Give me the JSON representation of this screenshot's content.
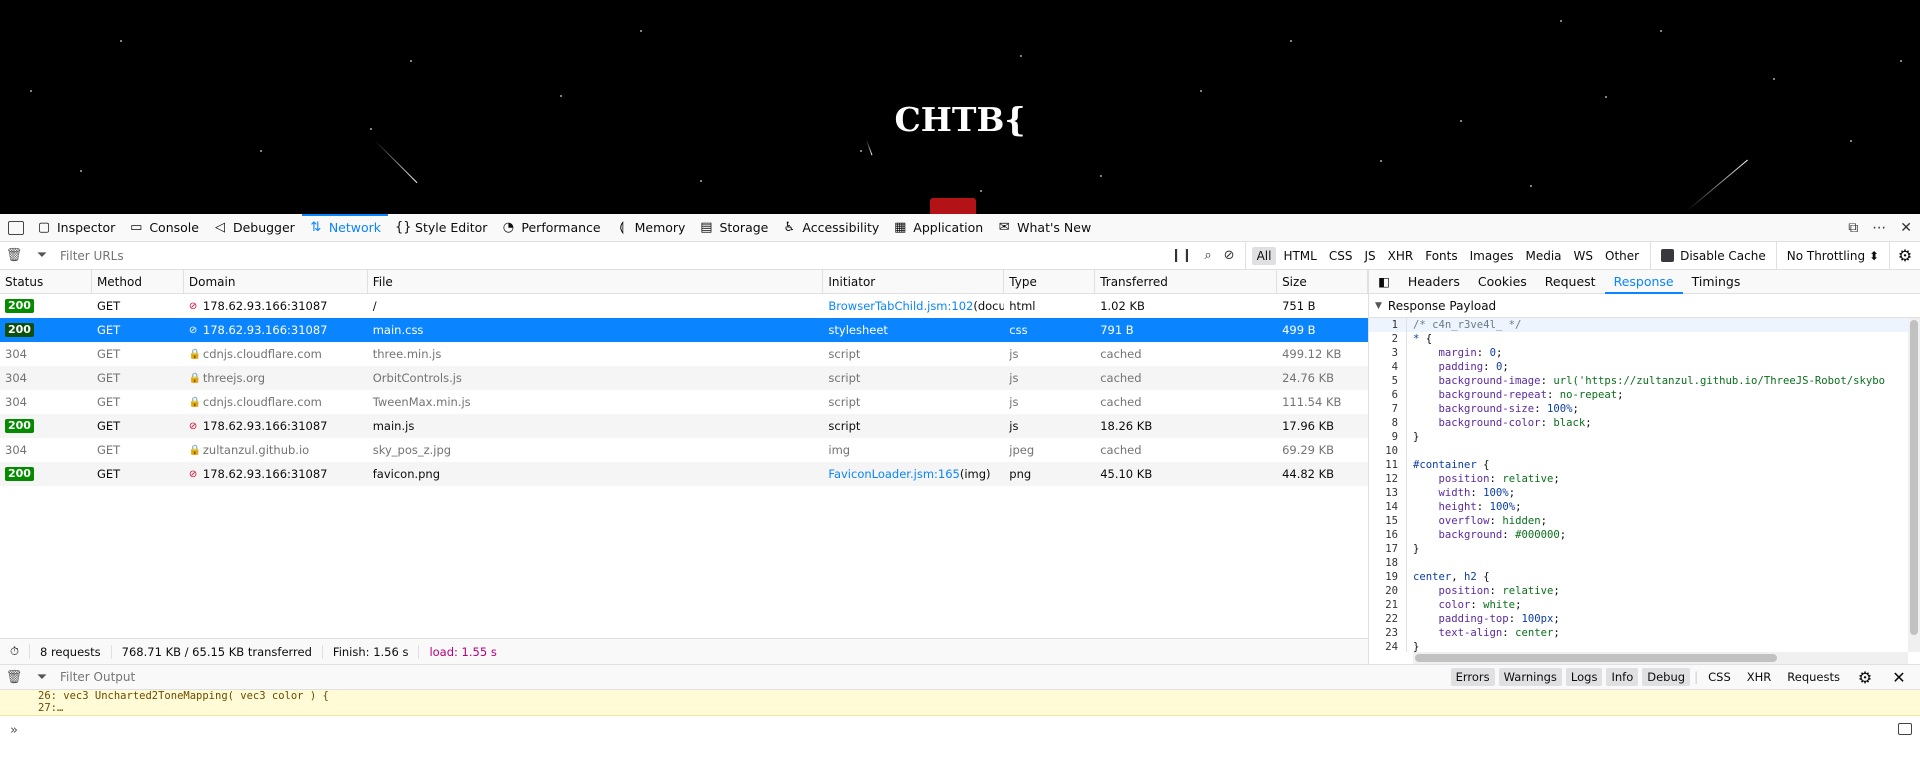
{
  "page": {
    "heading": "CHTB{"
  },
  "toolbar": {
    "tabs": [
      {
        "label": "Inspector",
        "icon": "inspector-icon"
      },
      {
        "label": "Console",
        "icon": "console-icon"
      },
      {
        "label": "Debugger",
        "icon": "debugger-icon"
      },
      {
        "label": "Network",
        "icon": "network-icon"
      },
      {
        "label": "Style Editor",
        "icon": "style-editor-icon"
      },
      {
        "label": "Performance",
        "icon": "performance-icon"
      },
      {
        "label": "Memory",
        "icon": "memory-icon"
      },
      {
        "label": "Storage",
        "icon": "storage-icon"
      },
      {
        "label": "Accessibility",
        "icon": "accessibility-icon"
      },
      {
        "label": "Application",
        "icon": "application-icon"
      },
      {
        "label": "What's New",
        "icon": "gift-icon"
      }
    ],
    "selected_tab": "Network"
  },
  "filter": {
    "placeholder": "Filter URLs",
    "types": [
      "All",
      "HTML",
      "CSS",
      "JS",
      "XHR",
      "Fonts",
      "Images",
      "Media",
      "WS",
      "Other"
    ],
    "active_type": "All",
    "disable_cache_label": "Disable Cache",
    "throttling": "No Throttling"
  },
  "columns": [
    "Status",
    "Method",
    "Domain",
    "File",
    "Initiator",
    "Type",
    "Transferred",
    "Size"
  ],
  "requests": [
    {
      "status": "200",
      "method": "GET",
      "domain": "178.62.93.166:31087",
      "secure": false,
      "file": "/",
      "initiator": "BrowserTabChild.jsm:102",
      "initiator_extra": " (docu...",
      "type": "html",
      "transferred": "1.02 KB",
      "size": "751 B",
      "cached": false,
      "selected": false
    },
    {
      "status": "200",
      "method": "GET",
      "domain": "178.62.93.166:31087",
      "secure": false,
      "file": "main.css",
      "initiator": "stylesheet",
      "initiator_extra": "",
      "type": "css",
      "transferred": "791 B",
      "size": "499 B",
      "cached": false,
      "selected": true
    },
    {
      "status": "304",
      "method": "GET",
      "domain": "cdnjs.cloudflare.com",
      "secure": true,
      "file": "three.min.js",
      "initiator": "script",
      "initiator_extra": "",
      "type": "js",
      "transferred": "cached",
      "size": "499.12 KB",
      "cached": true,
      "selected": false
    },
    {
      "status": "304",
      "method": "GET",
      "domain": "threejs.org",
      "secure": true,
      "file": "OrbitControls.js",
      "initiator": "script",
      "initiator_extra": "",
      "type": "js",
      "transferred": "cached",
      "size": "24.76 KB",
      "cached": true,
      "selected": false
    },
    {
      "status": "304",
      "method": "GET",
      "domain": "cdnjs.cloudflare.com",
      "secure": true,
      "file": "TweenMax.min.js",
      "initiator": "script",
      "initiator_extra": "",
      "type": "js",
      "transferred": "cached",
      "size": "111.54 KB",
      "cached": true,
      "selected": false
    },
    {
      "status": "200",
      "method": "GET",
      "domain": "178.62.93.166:31087",
      "secure": false,
      "file": "main.js",
      "initiator": "script",
      "initiator_extra": "",
      "type": "js",
      "transferred": "18.26 KB",
      "size": "17.96 KB",
      "cached": false,
      "selected": false
    },
    {
      "status": "304",
      "method": "GET",
      "domain": "zultanzul.github.io",
      "secure": true,
      "file": "sky_pos_z.jpg",
      "initiator": "img",
      "initiator_extra": "",
      "type": "jpeg",
      "transferred": "cached",
      "size": "69.29 KB",
      "cached": true,
      "selected": false
    },
    {
      "status": "200",
      "method": "GET",
      "domain": "178.62.93.166:31087",
      "secure": false,
      "file": "favicon.png",
      "initiator": "FaviconLoader.jsm:165",
      "initiator_extra": " (img)",
      "type": "png",
      "transferred": "45.10 KB",
      "size": "44.82 KB",
      "cached": false,
      "selected": false
    }
  ],
  "summary": {
    "requests": "8 requests",
    "transferred": "768.71 KB / 65.15 KB transferred",
    "finish": "Finish: 1.56 s",
    "load": "load: 1.55 s"
  },
  "side": {
    "tabs": [
      "Headers",
      "Cookies",
      "Request",
      "Response",
      "Timings"
    ],
    "selected_tab": "Response",
    "section_title": "Response Payload",
    "code_lines": [
      [
        [
          "comment",
          "/* c4n_r3ve4l_ */"
        ]
      ],
      [
        [
          "sel",
          "* "
        ],
        [
          "plain",
          "{"
        ]
      ],
      [
        [
          "plain",
          "    "
        ],
        [
          "prop",
          "margin"
        ],
        [
          "plain",
          ": "
        ],
        [
          "num",
          "0"
        ],
        [
          "plain",
          ";"
        ]
      ],
      [
        [
          "plain",
          "    "
        ],
        [
          "prop",
          "padding"
        ],
        [
          "plain",
          ": "
        ],
        [
          "num",
          "0"
        ],
        [
          "plain",
          ";"
        ]
      ],
      [
        [
          "plain",
          "    "
        ],
        [
          "prop",
          "background-image"
        ],
        [
          "plain",
          ": "
        ],
        [
          "val",
          "url('https://zultanzul.github.io/ThreeJS-Robot/skybo"
        ]
      ],
      [
        [
          "plain",
          "    "
        ],
        [
          "prop",
          "background-repeat"
        ],
        [
          "plain",
          ": "
        ],
        [
          "val",
          "no-repeat"
        ],
        [
          "plain",
          ";"
        ]
      ],
      [
        [
          "plain",
          "    "
        ],
        [
          "prop",
          "background-size"
        ],
        [
          "plain",
          ": "
        ],
        [
          "num",
          "100%"
        ],
        [
          "plain",
          ";"
        ]
      ],
      [
        [
          "plain",
          "    "
        ],
        [
          "prop",
          "background-color"
        ],
        [
          "plain",
          ": "
        ],
        [
          "val",
          "black"
        ],
        [
          "plain",
          ";"
        ]
      ],
      [
        [
          "plain",
          "}"
        ]
      ],
      [
        [
          "plain",
          ""
        ]
      ],
      [
        [
          "sel",
          "#container "
        ],
        [
          "plain",
          "{"
        ]
      ],
      [
        [
          "plain",
          "    "
        ],
        [
          "prop",
          "position"
        ],
        [
          "plain",
          ": "
        ],
        [
          "val",
          "relative"
        ],
        [
          "plain",
          ";"
        ]
      ],
      [
        [
          "plain",
          "    "
        ],
        [
          "prop",
          "width"
        ],
        [
          "plain",
          ": "
        ],
        [
          "num",
          "100%"
        ],
        [
          "plain",
          ";"
        ]
      ],
      [
        [
          "plain",
          "    "
        ],
        [
          "prop",
          "height"
        ],
        [
          "plain",
          ": "
        ],
        [
          "num",
          "100%"
        ],
        [
          "plain",
          ";"
        ]
      ],
      [
        [
          "plain",
          "    "
        ],
        [
          "prop",
          "overflow"
        ],
        [
          "plain",
          ": "
        ],
        [
          "val",
          "hidden"
        ],
        [
          "plain",
          ";"
        ]
      ],
      [
        [
          "plain",
          "    "
        ],
        [
          "prop",
          "background"
        ],
        [
          "plain",
          ": "
        ],
        [
          "val",
          "#000000"
        ],
        [
          "plain",
          ";"
        ]
      ],
      [
        [
          "plain",
          "}"
        ]
      ],
      [
        [
          "plain",
          ""
        ]
      ],
      [
        [
          "sel",
          "center"
        ],
        [
          "plain",
          ", "
        ],
        [
          "sel",
          "h2 "
        ],
        [
          "plain",
          "{"
        ]
      ],
      [
        [
          "plain",
          "    "
        ],
        [
          "prop",
          "position"
        ],
        [
          "plain",
          ": "
        ],
        [
          "val",
          "relative"
        ],
        [
          "plain",
          ";"
        ]
      ],
      [
        [
          "plain",
          "    "
        ],
        [
          "prop",
          "color"
        ],
        [
          "plain",
          ": "
        ],
        [
          "val",
          "white"
        ],
        [
          "plain",
          ";"
        ]
      ],
      [
        [
          "plain",
          "    "
        ],
        [
          "prop",
          "padding-top"
        ],
        [
          "plain",
          ": "
        ],
        [
          "num",
          "100px"
        ],
        [
          "plain",
          ";"
        ]
      ],
      [
        [
          "plain",
          "    "
        ],
        [
          "prop",
          "text-align"
        ],
        [
          "plain",
          ": "
        ],
        [
          "val",
          "center"
        ],
        [
          "plain",
          ";"
        ]
      ],
      [
        [
          "plain",
          "}"
        ]
      ]
    ]
  },
  "console": {
    "placeholder": "Filter Output",
    "levels": [
      "Errors",
      "Warnings",
      "Logs",
      "Info",
      "Debug"
    ],
    "types": [
      "CSS",
      "XHR",
      "Requests"
    ],
    "message_line1": "26: vec3 Uncharted2ToneMapping( vec3 color ) {",
    "message_line2": "27:…",
    "prompt": "»"
  },
  "colors": {
    "accent": "#0a84ff",
    "status_ok": "#058b00",
    "load": "#b5007f"
  }
}
